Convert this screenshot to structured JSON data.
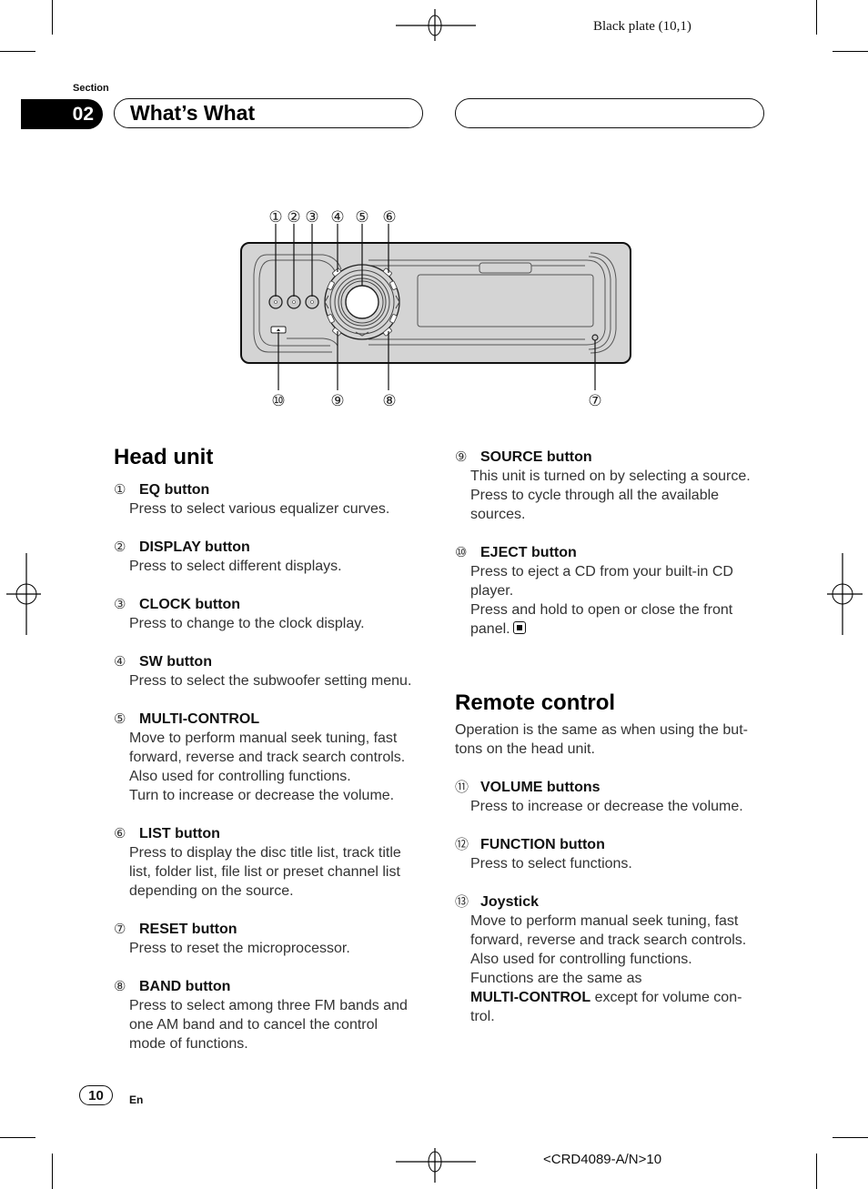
{
  "header": {
    "plate_text": "Black plate (10,1)",
    "section_label": "Section",
    "section_number": "02",
    "section_title": "What’s What"
  },
  "diagram": {
    "callouts_top": [
      "①",
      "②",
      "③",
      "④",
      "⑤",
      "⑥"
    ],
    "callouts_bottom": [
      "⑩",
      "⑨",
      "⑧",
      "⑦"
    ]
  },
  "head_unit": {
    "heading": "Head unit",
    "items": [
      {
        "num": "①",
        "title": "EQ button",
        "lines": [
          "Press to select various equalizer curves."
        ]
      },
      {
        "num": "②",
        "title": "DISPLAY button",
        "lines": [
          "Press to select different displays."
        ]
      },
      {
        "num": "③",
        "title": "CLOCK button",
        "lines": [
          "Press to change to the clock display."
        ]
      },
      {
        "num": "④",
        "title": "SW button",
        "lines": [
          "Press to select the subwoofer setting menu."
        ]
      },
      {
        "num": "⑤",
        "title": "MULTI-CONTROL",
        "lines": [
          "Move to perform manual seek tuning, fast",
          "forward, reverse and track search controls.",
          "Also used for controlling functions.",
          "Turn to increase or decrease the volume."
        ]
      },
      {
        "num": "⑥",
        "title": "LIST button",
        "lines": [
          "Press to display the disc title list, track title",
          "list, folder list, file list or preset channel list",
          "depending on the source."
        ]
      },
      {
        "num": "⑦",
        "title": "RESET button",
        "lines": [
          "Press to reset the microprocessor."
        ]
      },
      {
        "num": "⑧",
        "title": "BAND button",
        "lines": [
          "Press to select among three FM bands and",
          "one AM band and to cancel the control",
          "mode of functions."
        ]
      }
    ],
    "items_right": [
      {
        "num": "⑨",
        "title": "SOURCE button",
        "lines": [
          "This unit is turned on by selecting a source.",
          "Press to cycle through all the available",
          "sources."
        ]
      },
      {
        "num": "⑩",
        "title": "EJECT button",
        "lines": [
          "Press to eject a CD from your built-in CD",
          "player.",
          "Press and hold to open or close the front",
          "panel."
        ]
      }
    ],
    "end_icon": "stop-square-icon"
  },
  "remote_control": {
    "heading": "Remote control",
    "intro_lines": [
      "Operation is the same as when using the but-",
      "tons on the head unit."
    ],
    "items": [
      {
        "num": "⑪",
        "title": "VOLUME buttons",
        "lines": [
          "Press to increase or decrease the volume."
        ]
      },
      {
        "num": "⑫",
        "title": "FUNCTION button",
        "lines": [
          "Press to select functions."
        ]
      },
      {
        "num": "⑬",
        "title": "Joystick",
        "lines": [
          "Move to perform manual seek tuning, fast",
          "forward, reverse and track search controls.",
          "Also used for controlling functions.",
          "Functions are the same as"
        ],
        "last_bold": "MULTI-CONTROL",
        "last_rest": " except for volume con-",
        "tail": "trol."
      }
    ]
  },
  "footer": {
    "page_number": "10",
    "language": "En",
    "doc_code": "<CRD4089-A/N>10"
  }
}
